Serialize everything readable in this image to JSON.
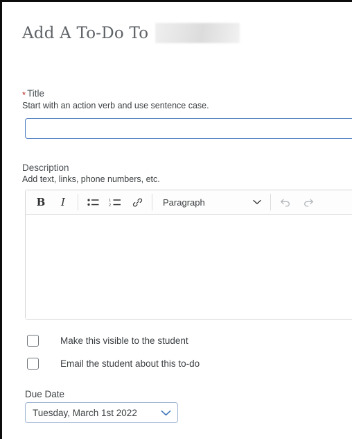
{
  "header": {
    "title": "Add A To-Do To",
    "redacted_name": ""
  },
  "title_field": {
    "label": "Title",
    "required_marker": "*",
    "helper": "Start with an action verb and use sentence case.",
    "value": "",
    "placeholder": ""
  },
  "description_field": {
    "label": "Description",
    "helper": "Add text, links, phone numbers, etc.",
    "value": "",
    "toolbar": {
      "bold_label": "B",
      "italic_label": "I",
      "bulleted_list_label": "bulleted-list",
      "numbered_list_label": "numbered-list",
      "link_label": "link",
      "format_select_value": "Paragraph",
      "undo_label": "undo",
      "redo_label": "redo"
    }
  },
  "checkboxes": [
    {
      "label": "Make this visible to the student",
      "checked": false
    },
    {
      "label": "Email the student about this to-do",
      "checked": false
    }
  ],
  "due_date": {
    "label": "Due Date",
    "value": "Tuesday, March 1st 2022"
  },
  "colors": {
    "focus_border": "#4a7cc0",
    "required_star": "#b3261e",
    "accent_chevron": "#3b73b9",
    "text": "#3c4043",
    "title_text": "#5f6367"
  }
}
